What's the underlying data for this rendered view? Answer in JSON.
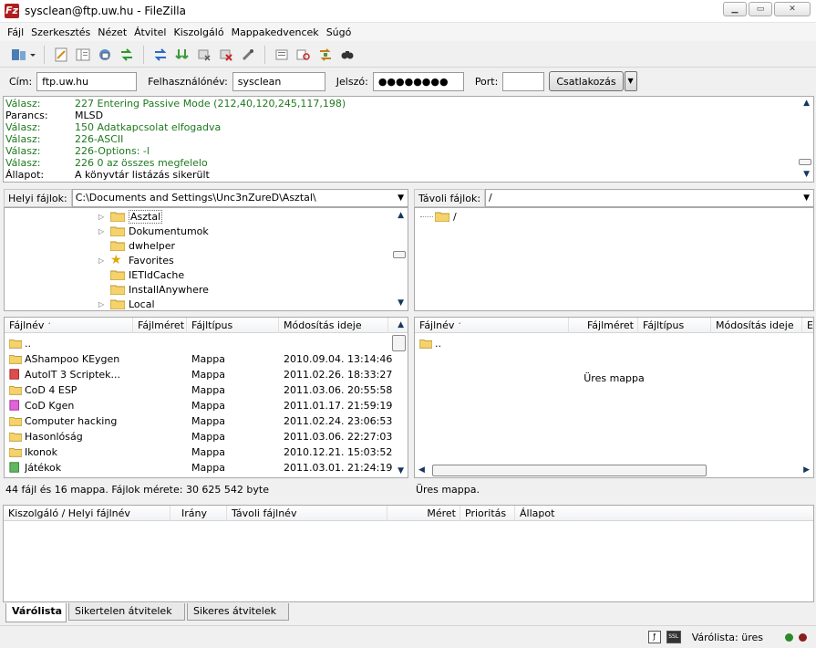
{
  "window": {
    "title": "sysclean@ftp.uw.hu - FileZilla",
    "app_icon_letter": "Fz"
  },
  "menu": [
    "Fájl",
    "Szerkesztés",
    "Nézet",
    "Átvitel",
    "Kiszolgáló",
    "Mappakedvencek",
    "Súgó"
  ],
  "quickconnect": {
    "host_label": "Cím:",
    "host_value": "ftp.uw.hu",
    "user_label": "Felhasználónév:",
    "user_value": "sysclean",
    "pass_label": "Jelszó:",
    "pass_value": "●●●●●●●●",
    "port_label": "Port:",
    "port_value": "",
    "connect_label": "Csatlakozás"
  },
  "log": [
    {
      "type": "Válasz:",
      "msg": "227 Entering Passive Mode (212,40,120,245,117,198)",
      "color": "#1d7a1d"
    },
    {
      "type": "Parancs:",
      "msg": "MLSD",
      "color": "#000000"
    },
    {
      "type": "Válasz:",
      "msg": "150 Adatkapcsolat elfogadva",
      "color": "#1d7a1d"
    },
    {
      "type": "Válasz:",
      "msg": "226-ASCII",
      "color": "#1d7a1d"
    },
    {
      "type": "Válasz:",
      "msg": "226-Options: -l",
      "color": "#1d7a1d"
    },
    {
      "type": "Válasz:",
      "msg": "226 0 az összes megfelelo",
      "color": "#1d7a1d"
    },
    {
      "type": "Állapot:",
      "msg": "A könyvtár listázás sikerült",
      "color": "#000000"
    }
  ],
  "local": {
    "path_label": "Helyi fájlok:",
    "path": "C:\\Documents and Settings\\Unc3nZureD\\Asztal\\",
    "tree": [
      {
        "name": "Asztal",
        "expander": true,
        "icon": "folder-icon"
      },
      {
        "name": "Dokumentumok",
        "expander": true,
        "icon": "folder-icon"
      },
      {
        "name": "dwhelper",
        "expander": false,
        "icon": "folder-icon"
      },
      {
        "name": "Favorites",
        "expander": true,
        "icon": "star-icon"
      },
      {
        "name": "IETldCache",
        "expander": false,
        "icon": "folder-icon"
      },
      {
        "name": "InstallAnywhere",
        "expander": false,
        "icon": "folder-icon"
      },
      {
        "name": "Local",
        "expander": true,
        "icon": "folder-icon"
      }
    ],
    "columns": [
      "Fájlnév",
      "Fájlméret",
      "Fájltípus",
      "Módosítás ideje"
    ],
    "files": [
      {
        "name": "..",
        "size": "",
        "type": "",
        "modified": "",
        "icon": "folder-icon"
      },
      {
        "name": "AShampoo KEygen",
        "size": "",
        "type": "Mappa",
        "modified": "2010.09.04. 13:14:46",
        "icon": "folder-icon"
      },
      {
        "name": "AutoIT 3 Scriptek...",
        "size": "",
        "type": "Mappa",
        "modified": "2011.02.26. 18:33:27",
        "icon": "red-folder-icon"
      },
      {
        "name": "CoD 4 ESP",
        "size": "",
        "type": "Mappa",
        "modified": "2011.03.06. 20:55:58",
        "icon": "folder-icon"
      },
      {
        "name": "CoD Kgen",
        "size": "",
        "type": "Mappa",
        "modified": "2011.01.17. 21:59:19",
        "icon": "pink-folder-icon"
      },
      {
        "name": "Computer hacking",
        "size": "",
        "type": "Mappa",
        "modified": "2011.02.24. 23:06:53",
        "icon": "folder-icon"
      },
      {
        "name": "Hasonlóság",
        "size": "",
        "type": "Mappa",
        "modified": "2011.03.06. 22:27:03",
        "icon": "folder-icon"
      },
      {
        "name": "Ikonok",
        "size": "",
        "type": "Mappa",
        "modified": "2010.12.21. 15:03:52",
        "icon": "folder-icon"
      },
      {
        "name": "Játékok",
        "size": "",
        "type": "Mappa",
        "modified": "2011.03.01. 21:24:19",
        "icon": "green-folder-icon"
      }
    ],
    "status": "44 fájl és 16 mappa. Fájlok mérete: 30 625 542 byte"
  },
  "remote": {
    "path_label": "Távoli fájlok:",
    "path": "/",
    "tree": [
      {
        "name": "/",
        "icon": "folder-icon"
      }
    ],
    "columns": [
      "Fájlnév",
      "Fájlméret",
      "Fájltípus",
      "Módosítás ideje",
      "Er"
    ],
    "files": [
      {
        "name": "..",
        "icon": "folder-icon"
      }
    ],
    "empty_text": "Üres mappa",
    "status": "Üres mappa."
  },
  "queue": {
    "columns": [
      "Kiszolgáló / Helyi fájlnév",
      "Irány",
      "Távoli fájlnév",
      "Méret",
      "Prioritás",
      "Állapot"
    ],
    "tabs": [
      "Várólista",
      "Sikertelen átvitelek",
      "Sikeres átvitelek"
    ]
  },
  "statusbar": {
    "queue_text": "Várólista: üres"
  },
  "colors": {
    "log_green": "#1d7a1d",
    "folder_yellow": "#f5d26b",
    "led_green": "#2a8a2a",
    "led_red": "#8a1f1f"
  }
}
